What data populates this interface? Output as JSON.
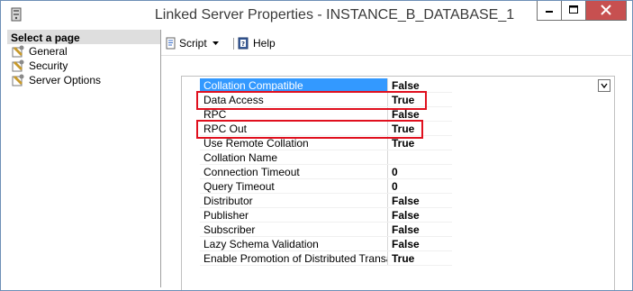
{
  "window": {
    "title": "Linked Server Properties - INSTANCE_B_DATABASE_1"
  },
  "left_pane": {
    "header": "Select a page",
    "items": [
      {
        "label": "General",
        "icon": "wrench-page-icon"
      },
      {
        "label": "Security",
        "icon": "wrench-page-icon"
      },
      {
        "label": "Server Options",
        "icon": "wrench-page-icon"
      }
    ]
  },
  "toolbar": {
    "script_label": "Script",
    "help_label": "Help"
  },
  "properties": [
    {
      "name": "Collation Compatible",
      "value": "False"
    },
    {
      "name": "Data Access",
      "value": "True"
    },
    {
      "name": "RPC",
      "value": "False"
    },
    {
      "name": "RPC Out",
      "value": "True"
    },
    {
      "name": "Use Remote Collation",
      "value": "True"
    },
    {
      "name": "Collation Name",
      "value": ""
    },
    {
      "name": "Connection Timeout",
      "value": "0"
    },
    {
      "name": "Query Timeout",
      "value": "0"
    },
    {
      "name": "Distributor",
      "value": "False"
    },
    {
      "name": "Publisher",
      "value": "False"
    },
    {
      "name": "Subscriber",
      "value": "False"
    },
    {
      "name": "Lazy Schema Validation",
      "value": "False"
    },
    {
      "name": "Enable Promotion of Distributed Transaction",
      "value": "True"
    }
  ],
  "colors": {
    "selection": "#3399ff",
    "highlight": "#e0101e",
    "close_button": "#c75050"
  }
}
